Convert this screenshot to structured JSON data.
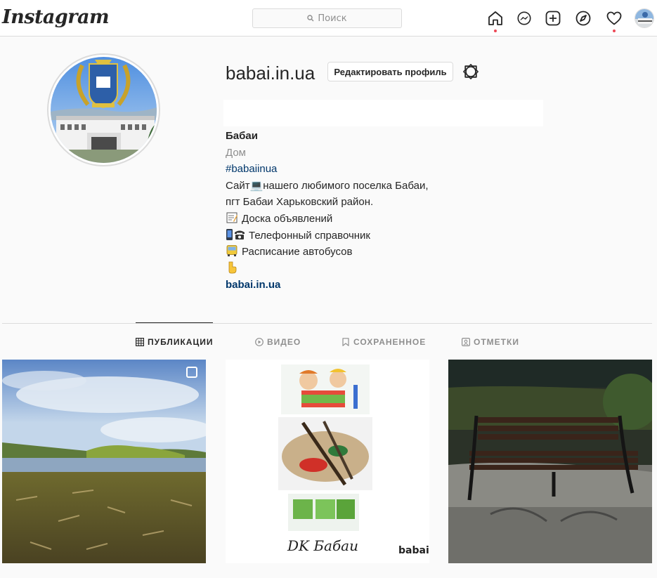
{
  "header": {
    "logo": "Instagram",
    "search_placeholder": "Поиск"
  },
  "profile": {
    "username": "babai.in.ua",
    "edit_label": "Редактировать профиль",
    "name": "Бабаи",
    "category": "Дом",
    "hashtag": "#babaiinua",
    "bio_line1": "Сайт💻нашего любимого поселка Бабаи,",
    "bio_line2": "пгт Бабаи Харьковский район.",
    "bio_line3": "Доска объявлений",
    "bio_line4": "Телефонный справочник",
    "bio_line5": "Расписание автобусов",
    "website": "babai.in.ua"
  },
  "tabs": [
    {
      "label": "ПУБЛИКАЦИИ",
      "active": true
    },
    {
      "label": "ВИДЕО",
      "active": false
    },
    {
      "label": "СОХРАНЕННОЕ",
      "active": false
    },
    {
      "label": "ОТМЕТКИ",
      "active": false
    }
  ],
  "posts": [
    {
      "caption": ""
    },
    {
      "caption": "DK Бабаи",
      "watermark": "babai."
    },
    {
      "caption": ""
    }
  ],
  "colors": {
    "link": "#00376b",
    "notification_dot": "#ed4956",
    "border": "#dbdbdb",
    "muted": "#8e8e8e"
  }
}
